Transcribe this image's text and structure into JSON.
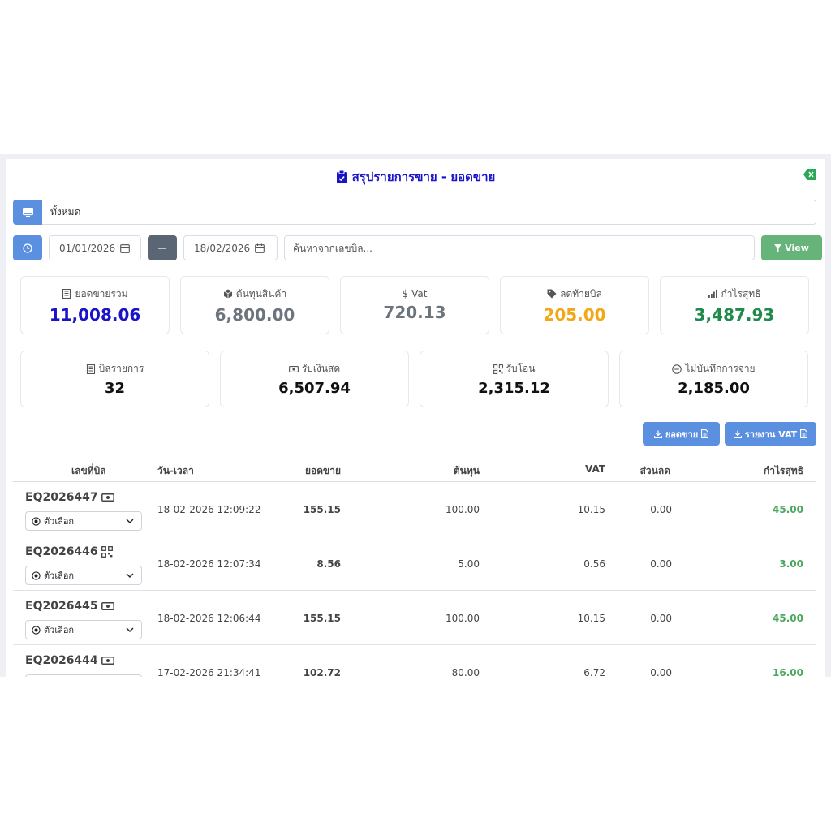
{
  "modal": {
    "title": "สรุปรายการขาย - ยอดขาย",
    "colors": {
      "title": "#1a14c9",
      "accent": "#5b8fe0",
      "view": "#66b47a",
      "close": "#2aa85a"
    }
  },
  "filters": {
    "branch": "ทั้งหมด",
    "date_from": "01/01/2026",
    "date_to": "18/02/2026",
    "search_placeholder": "ค้นหาจากเลขบิล...",
    "view_label": "View"
  },
  "summary": [
    {
      "label": "ยอดขายรวม",
      "value": "11,008.06",
      "color": "#1a14c9",
      "icon": "receipt-icon"
    },
    {
      "label": "ต้นทุนสินค้า",
      "value": "6,800.00",
      "color": "#6c757d",
      "icon": "box-icon"
    },
    {
      "label": "Vat",
      "value": "720.13",
      "color": "#6c757d",
      "icon": "dollar-icon"
    },
    {
      "label": "ลดท้ายบิล",
      "value": "205.00",
      "color": "#f0a818",
      "icon": "tag-icon"
    },
    {
      "label": "กำไรสุทธิ",
      "value": "3,487.93",
      "color": "#1f8a4c",
      "icon": "chart-icon"
    }
  ],
  "payments": [
    {
      "label": "บิลรายการ",
      "value": "32",
      "icon": "receipt-icon"
    },
    {
      "label": "รับเงินสด",
      "value": "6,507.94",
      "icon": "cash-icon"
    },
    {
      "label": "รับโอน",
      "value": "2,315.12",
      "icon": "qr-icon"
    },
    {
      "label": "ไม่บันทึกการจ่าย",
      "value": "2,185.00",
      "icon": "minus-circle-icon"
    }
  ],
  "exports": {
    "sales_label": "ยอดขาย",
    "vat_label": "รายงาน VAT"
  },
  "table": {
    "headers": {
      "bill": "เลขที่บิล",
      "datetime": "วัน-เวลา",
      "sales": "ยอดขาย",
      "cost": "ต้นทุน",
      "vat": "VAT",
      "discount": "ส่วนลด",
      "profit": "กำไรสุทธิ"
    },
    "option_label": "ตัวเลือก",
    "rows": [
      {
        "bill": "EQ2026447",
        "pay_icon": "cash-icon",
        "datetime": "18-02-2026 12:09:22",
        "sales": "155.15",
        "cost": "100.00",
        "vat": "10.15",
        "discount": "0.00",
        "profit": "45.00"
      },
      {
        "bill": "EQ2026446",
        "pay_icon": "qr-icon",
        "datetime": "18-02-2026 12:07:34",
        "sales": "8.56",
        "cost": "5.00",
        "vat": "0.56",
        "discount": "0.00",
        "profit": "3.00"
      },
      {
        "bill": "EQ2026445",
        "pay_icon": "cash-icon",
        "datetime": "18-02-2026 12:06:44",
        "sales": "155.15",
        "cost": "100.00",
        "vat": "10.15",
        "discount": "0.00",
        "profit": "45.00"
      },
      {
        "bill": "EQ2026444",
        "pay_icon": "cash-icon",
        "datetime": "17-02-2026 21:34:41",
        "sales": "102.72",
        "cost": "80.00",
        "vat": "6.72",
        "discount": "0.00",
        "profit": "16.00"
      }
    ]
  }
}
